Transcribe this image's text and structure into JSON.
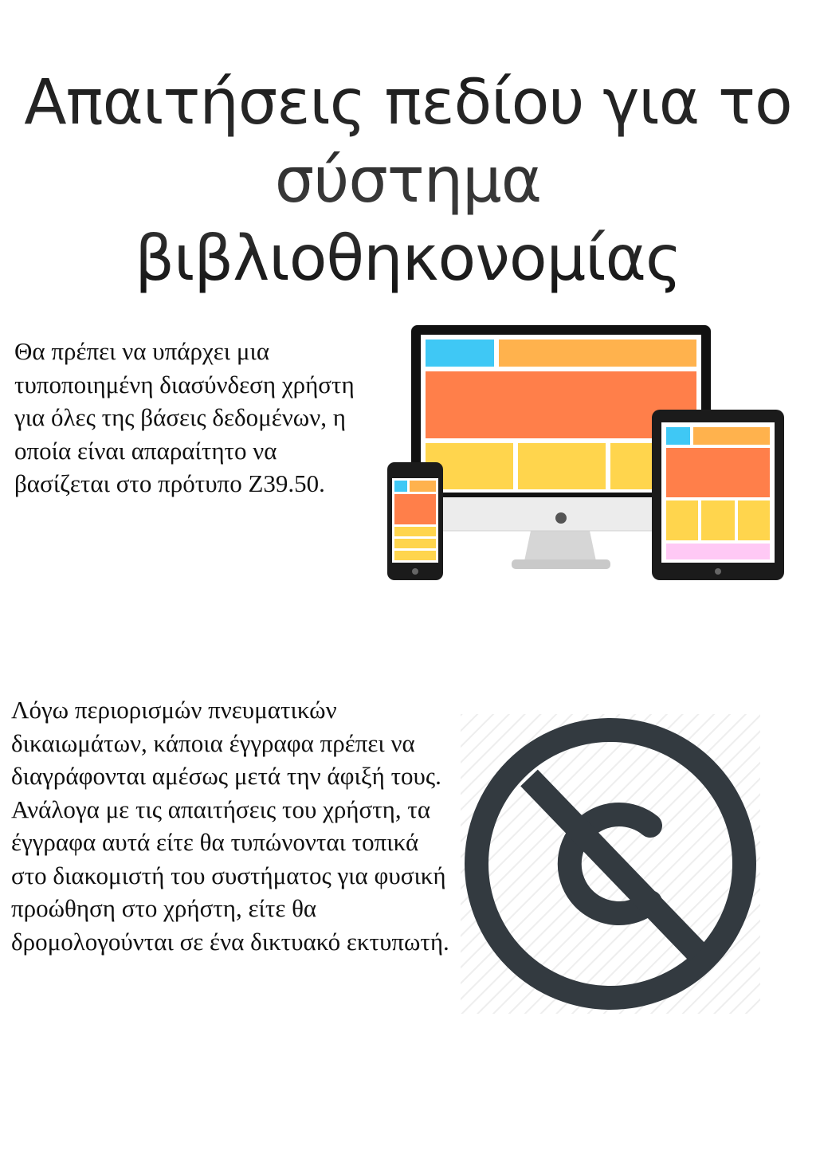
{
  "title": {
    "line1": "Απαιτήσεις πεδίου για το",
    "line2": "σύστημα βιβλιοθηκονομίας"
  },
  "section1": {
    "text": "Θα πρέπει να υπάρχει μια τυποποιημένη διασύνδεση χρήστη για όλες της βάσεις δεδομένων, η οποία είναι απαραίτητο να βασίζεται στο πρότυπο Z39.50.",
    "illustration": "responsive-devices-icon"
  },
  "section2": {
    "text": "Λόγω περιορισμών πνευματικών δικαιωμάτων, κάποια έγγραφα πρέπει να διαγράφονται αμέσως μετά την άφιξή τους. Ανάλογα με τις απαιτήσεις του χρήστη, τα έγγραφα αυτά είτε θα τυπώνονται τοπικά στο διακομιστή του συστήματος για φυσική προώθηση στο χρήστη, είτε θα δρομολογούνται σε ένα δικτυακό εκτυπωτή.",
    "illustration": "no-copyright-icon"
  },
  "colors": {
    "blue": "#3fc8f5",
    "orange_light": "#ffb24d",
    "orange": "#ff7f4a",
    "yellow": "#ffd54d",
    "pink": "#ffc9f5",
    "icon_dark": "#333a40"
  }
}
